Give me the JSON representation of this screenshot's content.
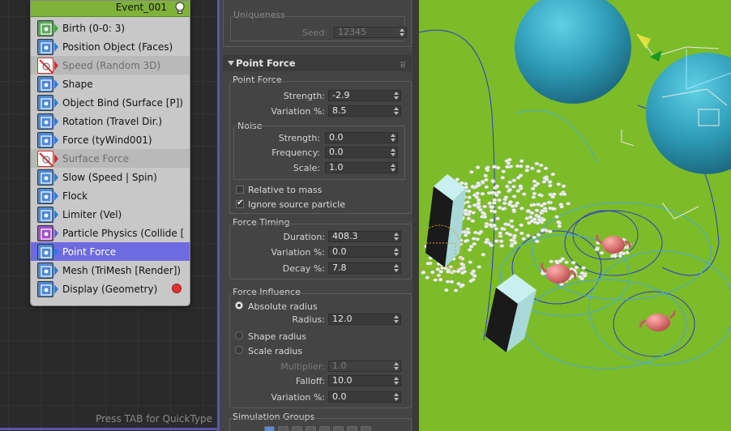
{
  "event": {
    "title": "Event_001",
    "operators": [
      {
        "label": "Birth (0-0: 3)",
        "icon": "birth-icon",
        "state": "normal",
        "color": "#4aa84a"
      },
      {
        "label": "Position Object (Faces)",
        "icon": "position-object-icon",
        "state": "normal",
        "color": "#3a7ad8"
      },
      {
        "label": "Speed (Random 3D)",
        "icon": "speed-icon",
        "state": "disabled",
        "color": "#d03030"
      },
      {
        "label": "Shape",
        "icon": "shape-icon",
        "state": "normal",
        "color": "#3a7ad8"
      },
      {
        "label": "Object Bind (Surface [P])",
        "icon": "object-bind-icon",
        "state": "normal",
        "color": "#3a7ad8"
      },
      {
        "label": "Rotation (Travel Dir.)",
        "icon": "rotation-icon",
        "state": "normal",
        "color": "#3a7ad8"
      },
      {
        "label": "Force (tyWind001)",
        "icon": "force-icon",
        "state": "normal",
        "color": "#3a7ad8"
      },
      {
        "label": "Surface Force",
        "icon": "surface-force-icon",
        "state": "disabled",
        "color": "#d03030"
      },
      {
        "label": "Slow (Speed | Spin)",
        "icon": "slow-icon",
        "state": "normal",
        "color": "#3a7ad8"
      },
      {
        "label": "Flock",
        "icon": "flock-icon",
        "state": "normal",
        "color": "#3a7ad8"
      },
      {
        "label": "Limiter (Vel)",
        "icon": "limiter-icon",
        "state": "normal",
        "color": "#3a7ad8"
      },
      {
        "label": "Particle Physics (Collide [In...",
        "icon": "particle-physics-icon",
        "state": "normal",
        "color": "#a040c0"
      },
      {
        "label": "Point Force",
        "icon": "point-force-icon",
        "state": "selected",
        "color": "#3a7ad8"
      },
      {
        "label": "Mesh (TriMesh [Render])",
        "icon": "mesh-icon",
        "state": "normal",
        "color": "#3a7ad8"
      },
      {
        "label": "Display (Geometry)",
        "icon": "display-icon",
        "state": "normal",
        "color": "#3a7ad8"
      }
    ]
  },
  "canvas": {
    "hint": "Press TAB for QuickType"
  },
  "uniqueness": {
    "title": "Uniqueness",
    "seed_label": "Seed:",
    "seed_value": "12345"
  },
  "point_force": {
    "title": "Point Force",
    "group_label": "Point Force",
    "strength_label": "Strength:",
    "strength_value": "-2.9",
    "variation_label": "Variation %:",
    "variation_value": "8.5",
    "noise": {
      "label": "Noise",
      "strength_label": "Strength:",
      "strength_value": "0.0",
      "frequency_label": "Frequency:",
      "frequency_value": "0.0",
      "scale_label": "Scale:",
      "scale_value": "1.0"
    },
    "relative_to_mass": {
      "label": "Relative to mass",
      "checked": false
    },
    "ignore_source": {
      "label": "Ignore source particle",
      "checked": true
    },
    "timing": {
      "label": "Force Timing",
      "duration_label": "Duration:",
      "duration_value": "408.3",
      "variation_label": "Variation %:",
      "variation_value": "0.0",
      "decay_label": "Decay %:",
      "decay_value": "7.8"
    },
    "influence": {
      "label": "Force Influence",
      "absolute_radius": "Absolute radius",
      "radius_label": "Radius:",
      "radius_value": "12.0",
      "shape_radius": "Shape radius",
      "scale_radius": "Scale radius",
      "multiplier_label": "Multiplier:",
      "multiplier_value": "1.0",
      "falloff_label": "Falloff:",
      "falloff_value": "10.0",
      "variation_label": "Variation %:",
      "variation_value": "0.0"
    },
    "simulation_groups": "Simulation Groups"
  },
  "colors": {
    "event_header": "#7fb239",
    "selected_row": "#6e6be0",
    "viewport_bg": "#7cbc28",
    "sphere": "#3aa8c0",
    "teapot": "#d06868"
  }
}
